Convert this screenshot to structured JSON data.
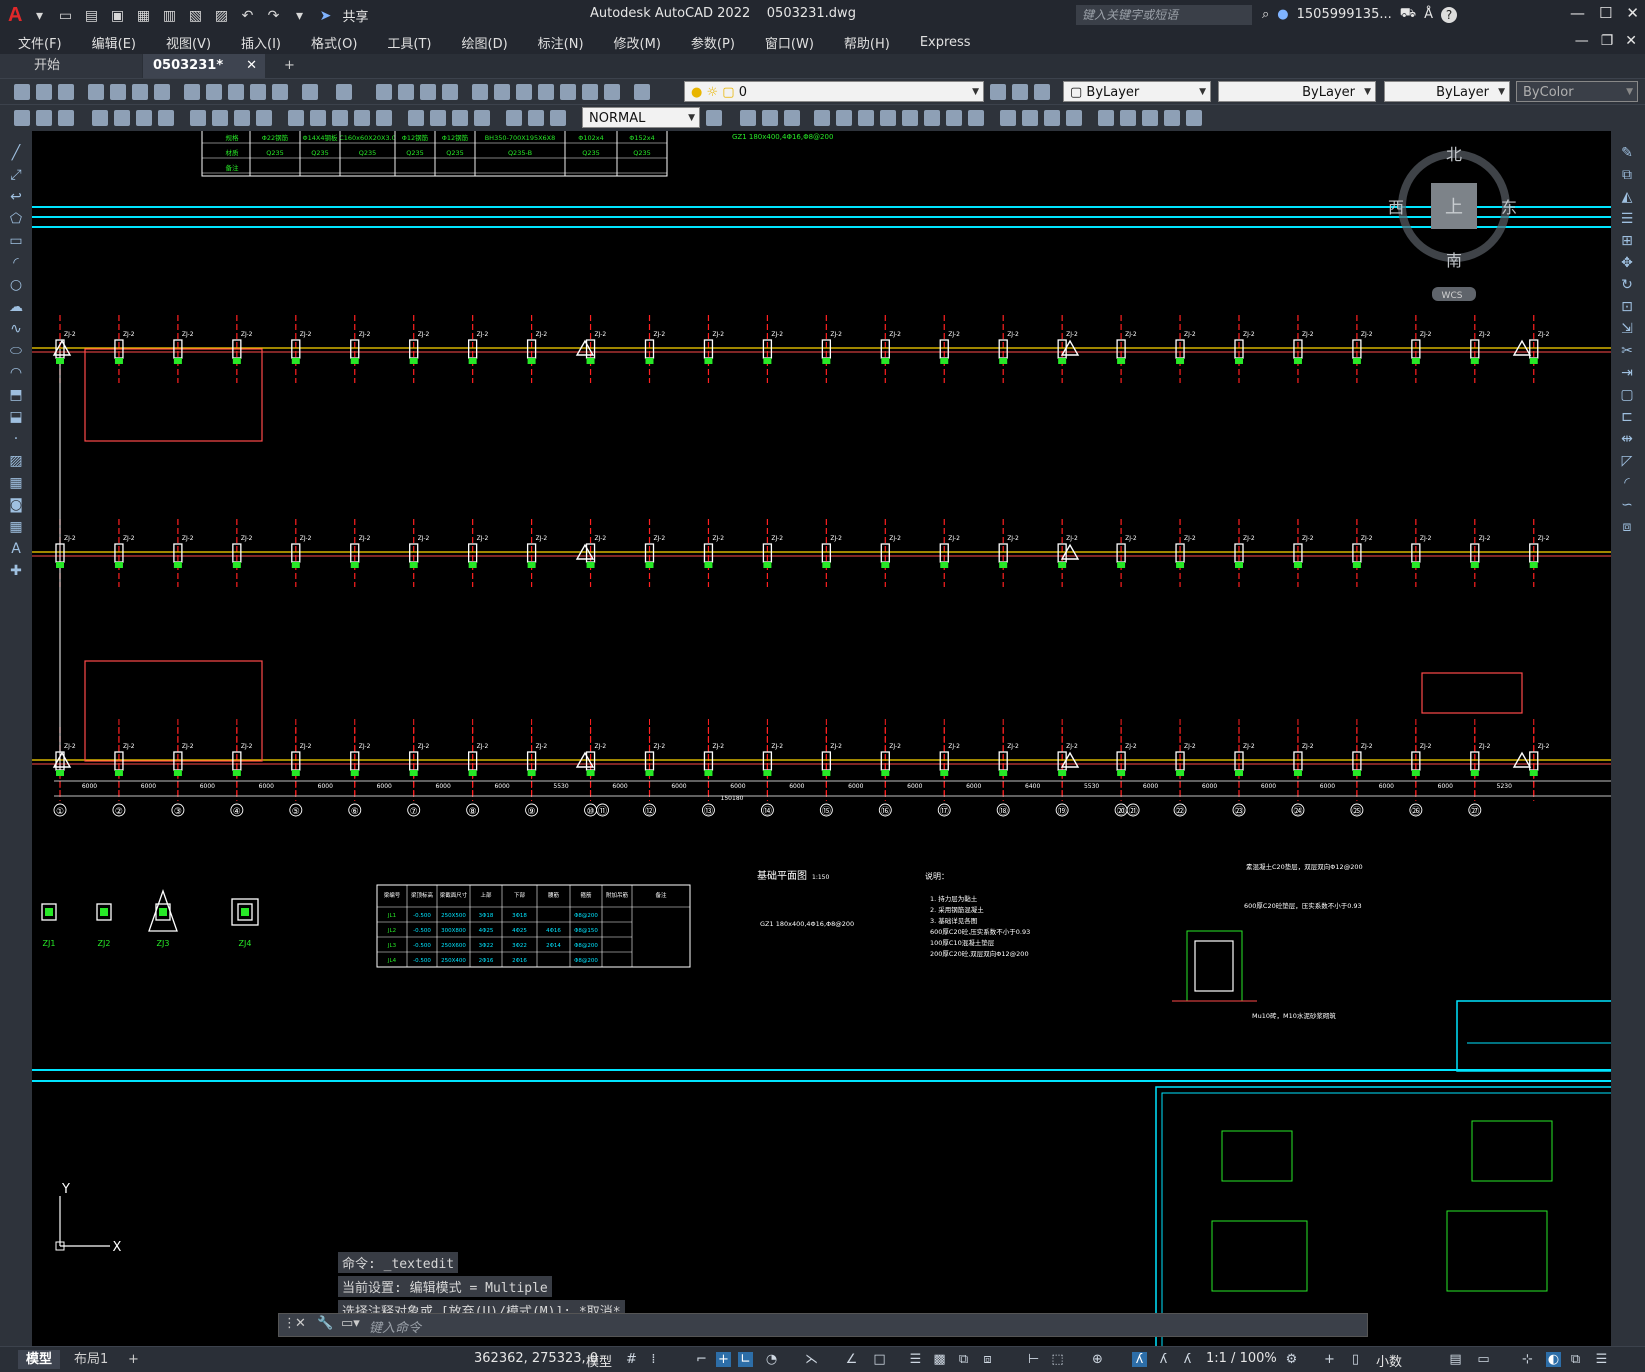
{
  "app": {
    "title": "Autodesk AutoCAD 2022    0503231.dwg",
    "logo_letter": "A",
    "share_label": "共享",
    "search_placeholder": "键入关键字或短语",
    "user": "1505999135...",
    "help": "?"
  },
  "menu": [
    "文件(F)",
    "编辑(E)",
    "视图(V)",
    "插入(I)",
    "格式(O)",
    "工具(T)",
    "绘图(D)",
    "标注(N)",
    "修改(M)",
    "参数(P)",
    "窗口(W)",
    "帮助(H)",
    "Express"
  ],
  "tabs": {
    "start": "开始",
    "file": "0503231*",
    "close": "✕",
    "add": "+"
  },
  "toolbar": {
    "layer_value": "0",
    "color_value": "ByLayer",
    "linetype_value": "ByLayer",
    "lineweight_value": "ByLayer",
    "plotstyle_value": "ByColor",
    "dimstyle_value": "NORMAL"
  },
  "viewcube": {
    "north": "北",
    "south": "南",
    "east": "东",
    "west": "西",
    "top": "上",
    "wcs": "WCS"
  },
  "drawing": {
    "grid_labels": [
      "①",
      "②",
      "③",
      "④",
      "⑤",
      "⑥",
      "⑦",
      "⑧",
      "⑨",
      "⑩",
      "⑪",
      "⑫",
      "⑬",
      "⑭",
      "⑮",
      "⑯",
      "⑰",
      "⑱",
      "⑲",
      "⑳",
      "㉑",
      "㉒",
      "㉓",
      "㉔",
      "㉕",
      "㉖",
      "㉗"
    ],
    "span_labels": [
      "6000",
      "6000",
      "6000",
      "6000",
      "6000",
      "6000",
      "6000",
      "6000",
      "5530",
      "6000",
      "6000",
      "6000",
      "6000",
      "6000",
      "6000",
      "6000",
      "6400",
      "5530",
      "6000",
      "6000",
      "6000",
      "6000",
      "6000",
      "6000",
      "5230"
    ],
    "total_length": "150180",
    "column_tag": "ZJ-2",
    "col_tags": [
      "ZJ1",
      "ZJ2",
      "ZJ3",
      "ZJ4"
    ],
    "plan_title": "基础平面图",
    "plan_scale": "1:150",
    "plan_note": "GZ1 180x400,4Φ16,Φ8@200",
    "notes_title": "说明：",
    "notes": [
      "1. 持力层为黏土",
      "2. 采用钢筋混凝土",
      "3. 基础详见各图",
      "600厚C20砼,压实系数不小于0.93",
      "100厚C10混凝土垫层",
      "200厚C20砼,双层双向Φ12@200"
    ],
    "beam_table": {
      "headers": [
        "梁编号",
        "梁顶标高",
        "梁截面尺寸",
        "上部",
        "下部",
        "腰筋",
        "箍筋",
        "附加吊筋",
        "备注"
      ],
      "rows": [
        [
          "JL1",
          "-0.500",
          "250X500",
          "3Φ18",
          "3Φ18",
          "",
          "Φ8@200"
        ],
        [
          "JL2",
          "-0.500",
          "300X800",
          "4Φ25",
          "4Φ25",
          "4Φ16",
          "Φ8@150"
        ],
        [
          "JL3",
          "-0.500",
          "250X600",
          "3Φ22",
          "3Φ22",
          "2Φ14",
          "Φ8@200"
        ],
        [
          "JL4",
          "-0.500",
          "250X400",
          "2Φ16",
          "2Φ16",
          "",
          "Φ8@200"
        ]
      ]
    },
    "material_table": {
      "rows": [
        [
          "规格",
          "Φ22钢筋",
          "Φ14X4钢板",
          "C160x60X20X3.0",
          "Φ12钢筋",
          "Φ12钢筋",
          "BH350-700X195X6X8",
          "Φ102x4",
          "Φ152x4"
        ],
        [
          "材质",
          "Q235",
          "Q235",
          "Q235",
          "Q235",
          "Q235",
          "Q235-B",
          "Q235",
          "Q235"
        ],
        [
          "备注",
          "",
          "",
          "",
          "",
          "",
          "",
          "",
          ""
        ]
      ]
    },
    "detail_notes": [
      "素混凝土C20垫层，双层双向Φ12@200",
      "600厚C20砼垫层，压实系数不小于0.93",
      "Mu10砖，M10水泥砂浆砌筑"
    ],
    "ucs_x": "X",
    "ucs_y": "Y"
  },
  "command": {
    "history": [
      "命令: _textedit",
      "当前设置: 编辑模式 = Multiple",
      "选择注释对象或 [放弃(U)/模式(M)]: *取消*"
    ],
    "placeholder": "键入命令"
  },
  "status": {
    "model_tab": "模型",
    "layout_tab": "布局1",
    "add_tab": "+",
    "coords": "362362, 275323, 0",
    "model_btn": "模型",
    "scale": "1:1 / 100%",
    "units": "小数"
  },
  "colors": {
    "canvas": "#000000",
    "grid_line": "#ff2020",
    "beam": "#ffd800",
    "column": "#ffffff",
    "cyan": "#00e5ff",
    "green": "#27e827"
  }
}
